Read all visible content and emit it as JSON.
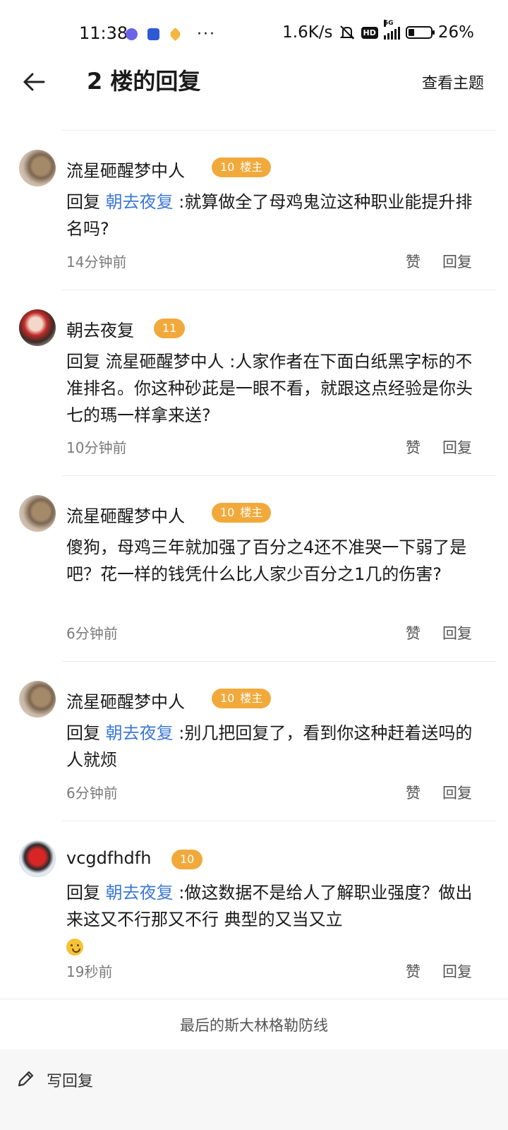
{
  "status_bar": {
    "time": "11:38",
    "network_speed": "1.6K/s",
    "hd_label": "HD",
    "signal_label": "5G",
    "battery_percent": "26%",
    "battery_level": 0.26
  },
  "header": {
    "title": "2 楼的回复",
    "view_topic": "查看主题"
  },
  "replies": [
    {
      "username": "流星砸醒梦中人",
      "level": "10",
      "owner_tag": "楼主",
      "prefix": "回复 ",
      "mention": "朝去夜复",
      "text": " :就算做全了母鸡鬼泣这种职业能提升排名吗?",
      "time": "14分钟前"
    },
    {
      "username": "朝去夜复",
      "level": "11",
      "owner_tag": "",
      "prefix": "",
      "mention": "",
      "text": "回复 流星砸醒梦中人 :人家作者在下面白纸黑字标的不准排名。你这种砂茈是一眼不看，就跟这点经验是你头七的瑪一样拿来送?",
      "time": "10分钟前"
    },
    {
      "username": "流星砸醒梦中人",
      "level": "10",
      "owner_tag": "楼主",
      "prefix": "",
      "mention": "",
      "text": "傻狗，母鸡三年就加强了百分之4还不准哭一下弱了是吧？花一样的钱凭什么比人家少百分之1几的伤害?",
      "time": "6分钟前"
    },
    {
      "username": "流星砸醒梦中人",
      "level": "10",
      "owner_tag": "楼主",
      "prefix": "回复 ",
      "mention": "朝去夜复",
      "text": " :别几把回复了，看到你这种赶着送吗的人就烦",
      "time": "6分钟前"
    },
    {
      "username": "vcgdfhdfh",
      "level": "10",
      "owner_tag": "",
      "prefix": "回复 ",
      "mention": "朝去夜复",
      "text": " :做这数据不是给人了解职业强度？做出来这又不行那又不行 典型的又当又立",
      "time": "19秒前"
    }
  ],
  "actions": {
    "like": "赞",
    "reply": "回复"
  },
  "footer": {
    "note": "最后的斯大林格勒防线",
    "write_reply": "写回复"
  },
  "icons": {
    "back": "back-arrow-icon",
    "write": "pencil-icon",
    "emoji": "grinning-emoji-icon"
  }
}
